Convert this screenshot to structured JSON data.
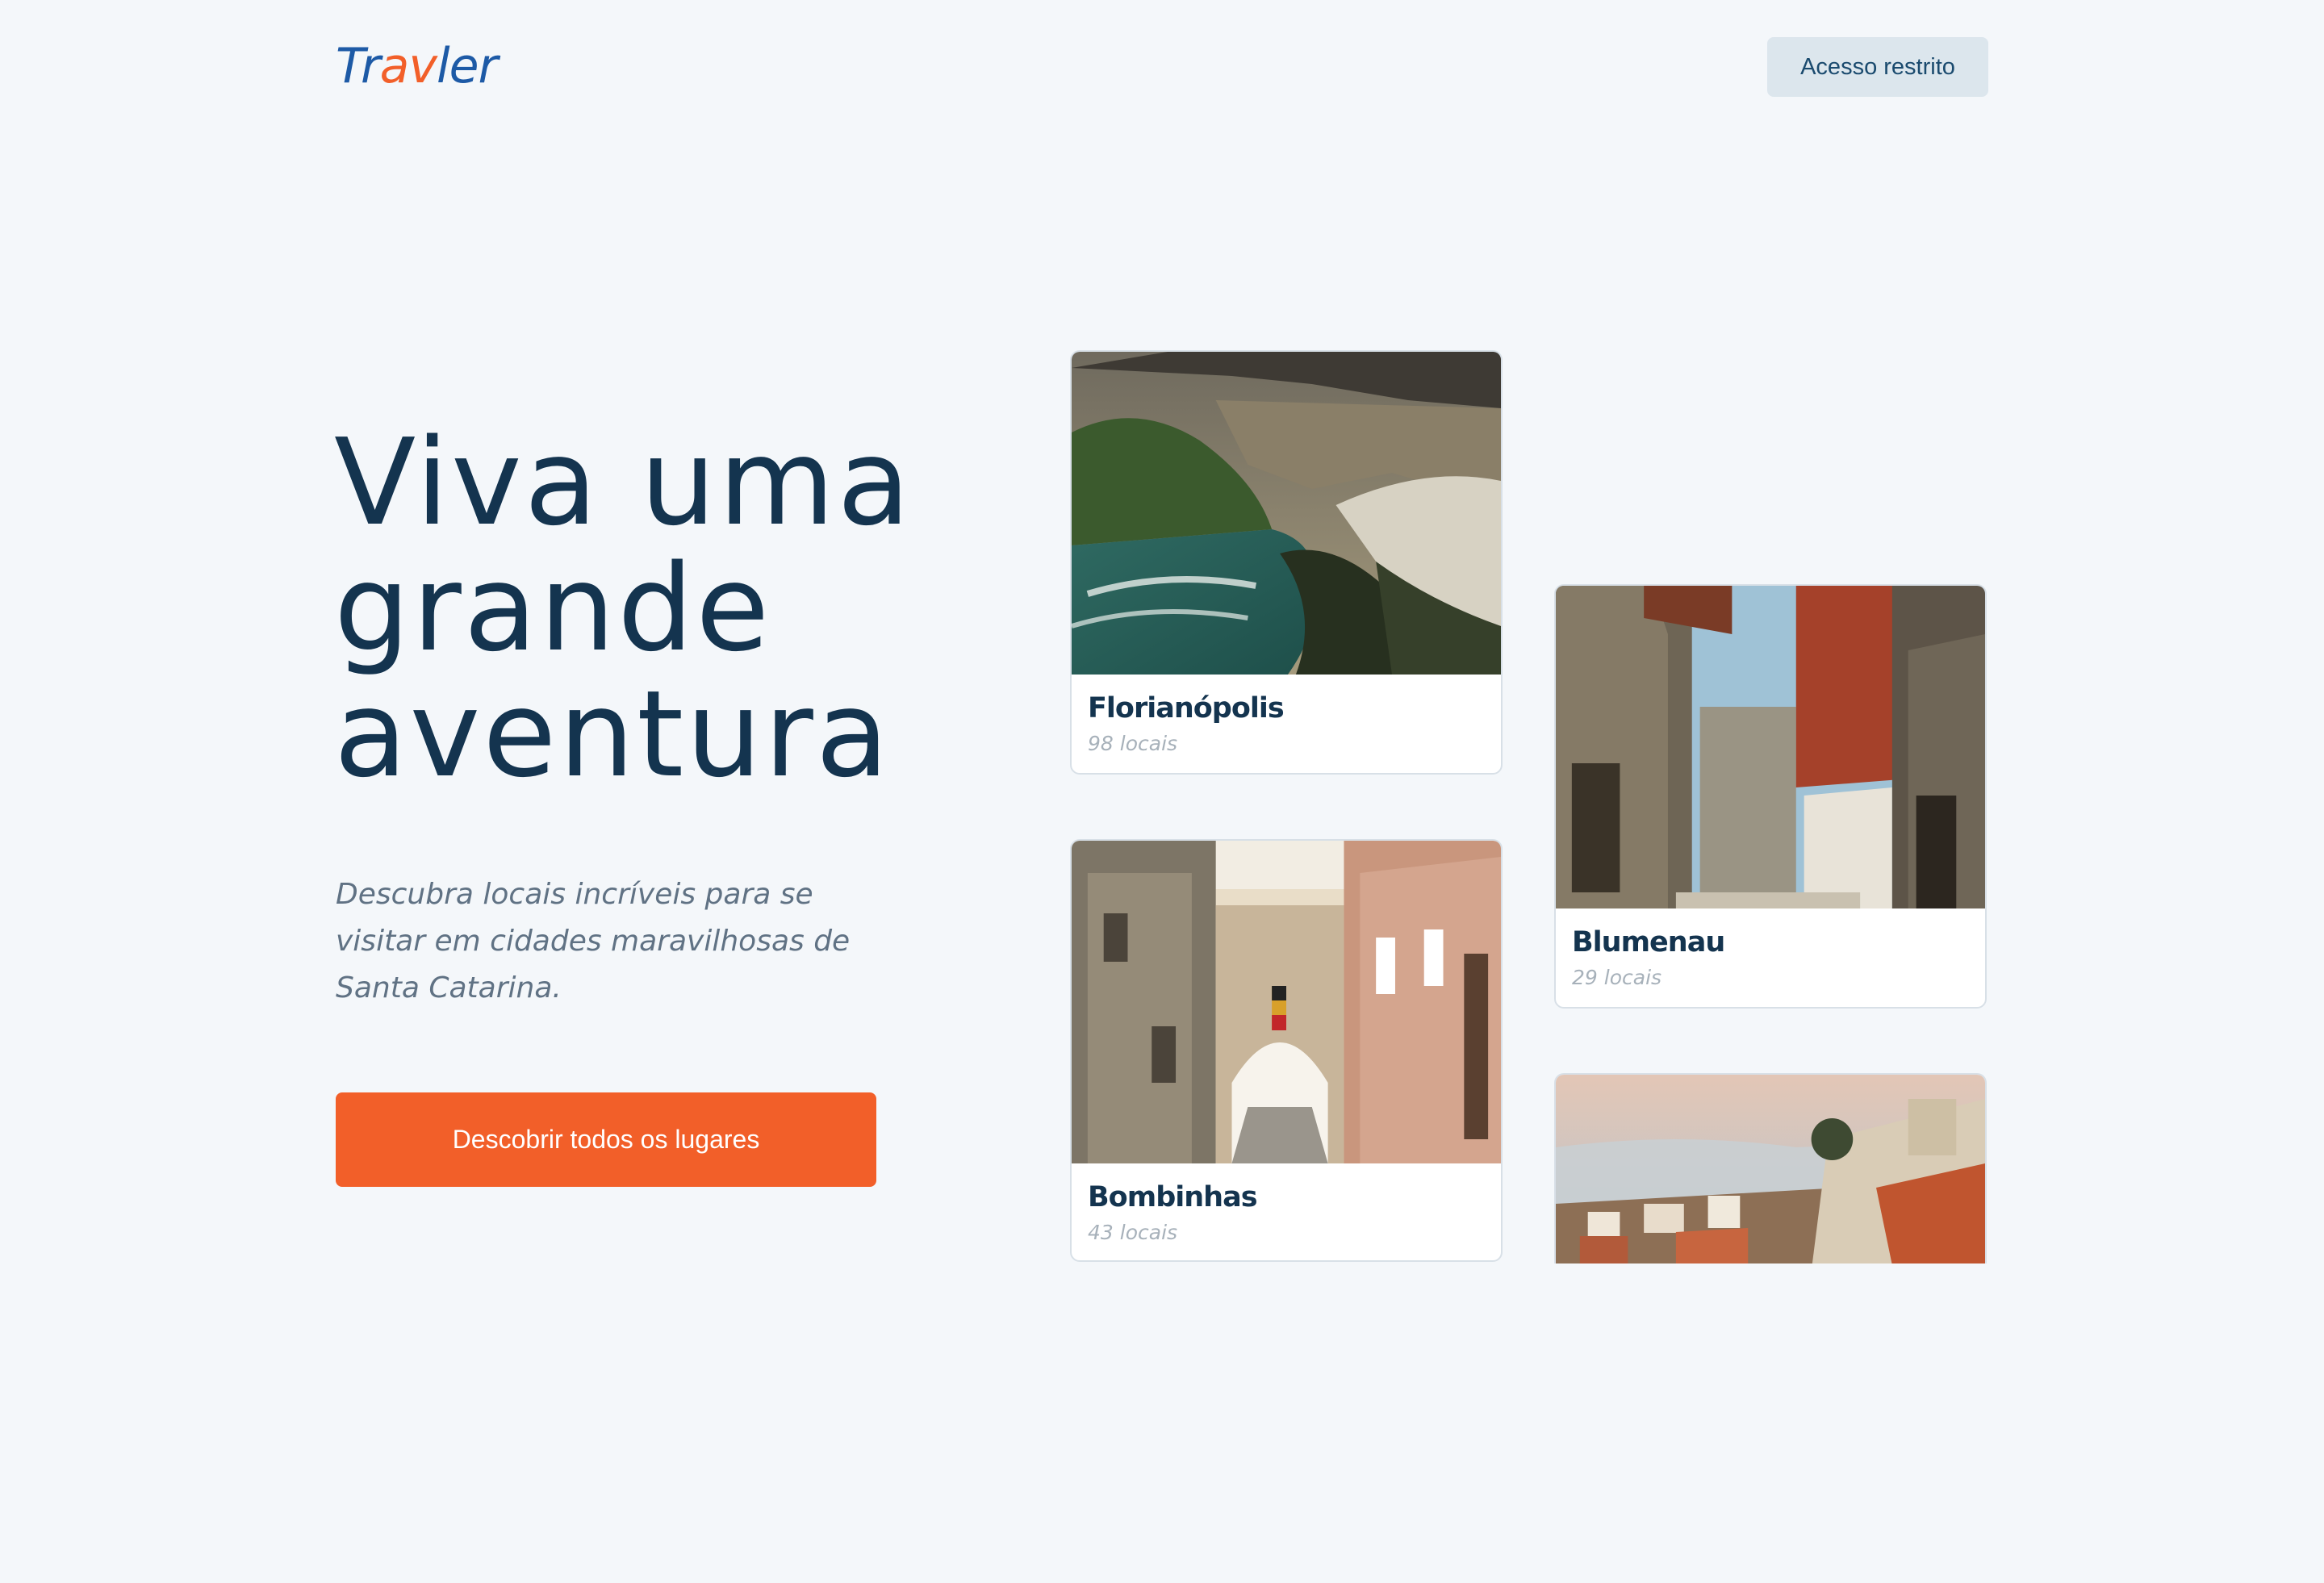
{
  "header": {
    "logo_prefix": "Tr",
    "logo_accent": "av",
    "logo_suffix": "ler",
    "access_button": "Acesso restrito"
  },
  "hero": {
    "title_line1": "Viva uma",
    "title_line2": "grande",
    "title_line3": "aventura",
    "description": "Descubra locais incríveis para se visitar em cidades maravilhosas de Santa Catarina.",
    "cta_label": "Descobrir todos os lugares"
  },
  "cities": [
    {
      "name": "Florianópolis",
      "count": "98 locais"
    },
    {
      "name": "Bombinhas",
      "count": "43 locais"
    },
    {
      "name": "Blumenau",
      "count": "29 locais"
    }
  ],
  "colors": {
    "background": "#f4f7fa",
    "primary_text": "#14344f",
    "brand_blue": "#1d5aa6",
    "accent_orange": "#f25f29",
    "muted_text": "#607284"
  }
}
